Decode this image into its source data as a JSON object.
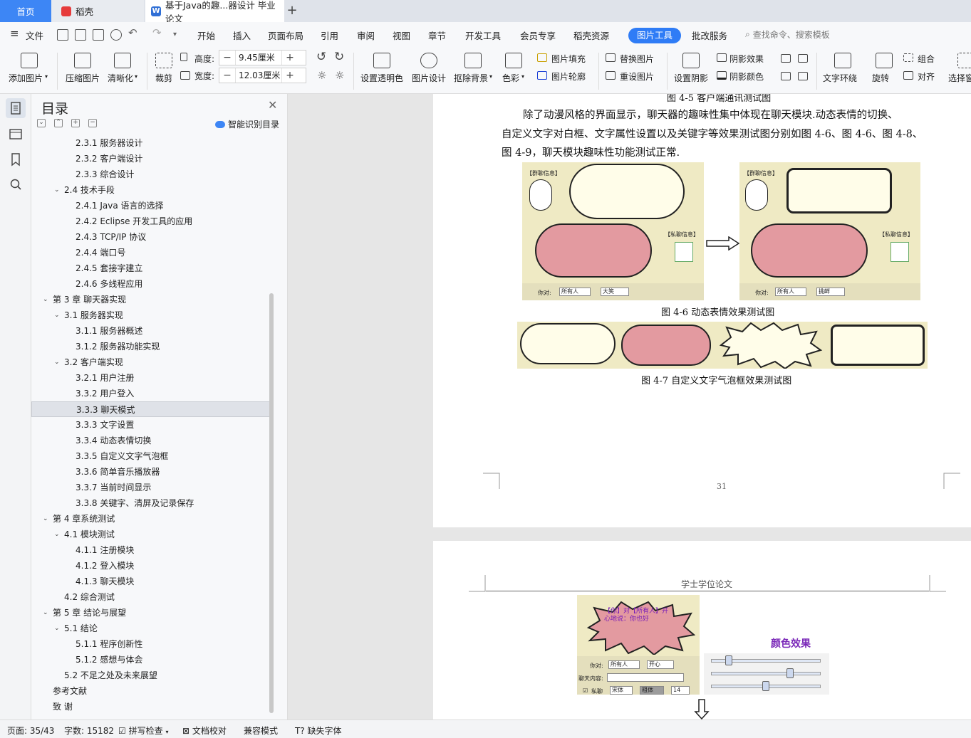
{
  "tabs": [
    {
      "label": "首页"
    },
    {
      "label": "稻壳"
    },
    {
      "label": "基于Java的趣...器设计 毕业论文"
    }
  ],
  "menu": {
    "file": "文件",
    "items": [
      "开始",
      "插入",
      "页面布局",
      "引用",
      "审阅",
      "视图",
      "章节",
      "开发工具",
      "会员专享",
      "稻壳资源"
    ],
    "active": "图片工具",
    "extra": "批改服务",
    "search_placeholder": "查找命令、搜索模板"
  },
  "ribbon": {
    "add_picture": "添加图片",
    "compress": "压缩图片",
    "sharpen": "清晰化",
    "crop": "裁剪",
    "height_label": "高度:",
    "height_value": "9.45厘米",
    "width_label": "宽度:",
    "width_value": "12.03厘米",
    "transparent": "设置透明色",
    "design": "图片设计",
    "remove_bg": "抠除背景",
    "color": "色彩",
    "fill": "图片填充",
    "outline": "图片轮廓",
    "replace": "替换图片",
    "reset": "重设图片",
    "shadow_set": "设置阴影",
    "shadow_effect": "阴影效果",
    "shadow_color": "阴影颜色",
    "wrap": "文字环绕",
    "rotate": "旋转",
    "group": "组合",
    "align": "对齐",
    "select": "选择窗"
  },
  "toc": {
    "title": "目录",
    "smart": "智能识别目录",
    "items": [
      {
        "text": "2.3.1  服务器设计",
        "level": 3
      },
      {
        "text": "2.3.2  客户端设计",
        "level": 3
      },
      {
        "text": "2.3.3  综合设计",
        "level": 3
      },
      {
        "text": "2.4  技术手段",
        "level": 2,
        "arrow": true
      },
      {
        "text": "2.4.1 Java 语言的选择",
        "level": 3
      },
      {
        "text": "2.4.2 Eclipse 开发工具的应用",
        "level": 3
      },
      {
        "text": "2.4.3 TCP/IP 协议",
        "level": 3
      },
      {
        "text": "2.4.4  端口号",
        "level": 3
      },
      {
        "text": "2.4.5  套接字建立",
        "level": 3
      },
      {
        "text": "2.4.6  多线程应用",
        "level": 3
      },
      {
        "text": "第 3 章  聊天器实现",
        "level": 1,
        "arrow": true
      },
      {
        "text": "3.1  服务器实现",
        "level": 2,
        "arrow": true
      },
      {
        "text": "3.1.1  服务器概述",
        "level": 3
      },
      {
        "text": "3.1.2  服务器功能实现",
        "level": 3
      },
      {
        "text": "3.2  客户端实现",
        "level": 2,
        "arrow": true
      },
      {
        "text": "3.2.1  用户注册",
        "level": 3
      },
      {
        "text": "3.3.2  用户登入",
        "level": 3
      },
      {
        "text": "3.3.3  聊天模式",
        "level": 3,
        "selected": true
      },
      {
        "text": "3.3.3  文字设置",
        "level": 3
      },
      {
        "text": "3.3.4  动态表情切换",
        "level": 3
      },
      {
        "text": "3.3.5  自定义文字气泡框",
        "level": 3
      },
      {
        "text": "3.3.6  简单音乐播放器",
        "level": 3
      },
      {
        "text": "3.3.7  当前时间显示",
        "level": 3
      },
      {
        "text": "3.3.8  关键字、清屏及记录保存",
        "level": 3
      },
      {
        "text": "第 4 章系统测试",
        "level": 1,
        "arrow": true
      },
      {
        "text": "4.1  模块测试",
        "level": 2,
        "arrow": true
      },
      {
        "text": "4.1.1  注册模块",
        "level": 3
      },
      {
        "text": "4.1.2  登入模块",
        "level": 3
      },
      {
        "text": "4.1.3  聊天模块",
        "level": 3
      },
      {
        "text": "4.2  综合测试",
        "level": 2
      },
      {
        "text": "第 5 章  结论与展望",
        "level": 1,
        "arrow": true
      },
      {
        "text": "5.1  结论",
        "level": 2,
        "arrow": true
      },
      {
        "text": "5.1.1  程序创新性",
        "level": 3
      },
      {
        "text": "5.1.2  感想与体会",
        "level": 3
      },
      {
        "text": "5.2  不足之处及未来展望",
        "level": 2
      },
      {
        "text": "参考文献",
        "level": 1
      },
      {
        "text": "致    谢",
        "level": 1
      }
    ]
  },
  "document": {
    "caption_top": "图 4-5  客户端通讯测试图",
    "para_line1": "除了动漫风格的界面显示，聊天器的趣味性集中体现在聊天模块.动态表情的切换、",
    "para_line2": "自定义文字对白框、文字属性设置以及关键字等效果测试图分别如图 4-6、图 4-6、图 4-8、",
    "para_line3": "图 4-9，聊天模块趣味性功能测试正常.",
    "caption_46": "图 4-6  动态表情效果测试图",
    "caption_47": "图 4-7  自定义文字气泡框效果测试图",
    "page_number": "31",
    "page2_header": "学士学位论文",
    "shot_group_msg": "【群聊信息】",
    "shot_private_msg": "【私聊信息】",
    "shot_to_label": "你对:",
    "shot_to_value": "所有人",
    "shot_expr_value1": "大笑",
    "shot_expr_value2": "挑衅",
    "shot3_msg": "【你】对【所有人】开心地说：你也好",
    "shot3_to_label": "你对:",
    "shot3_to_value": "所有人",
    "shot3_expr": "开心",
    "shot3_content_label": "聊天内容:",
    "shot3_private": "私聊",
    "shot3_font": "宋体",
    "shot3_style": "粗体",
    "shot3_size": "14",
    "color_effect": "颜色效果"
  },
  "status": {
    "page": "页面: 35/43",
    "words": "字数: 15182",
    "spell": "拼写检查",
    "proof": "文档校对",
    "compat": "兼容模式",
    "missing_font": "缺失字体"
  }
}
